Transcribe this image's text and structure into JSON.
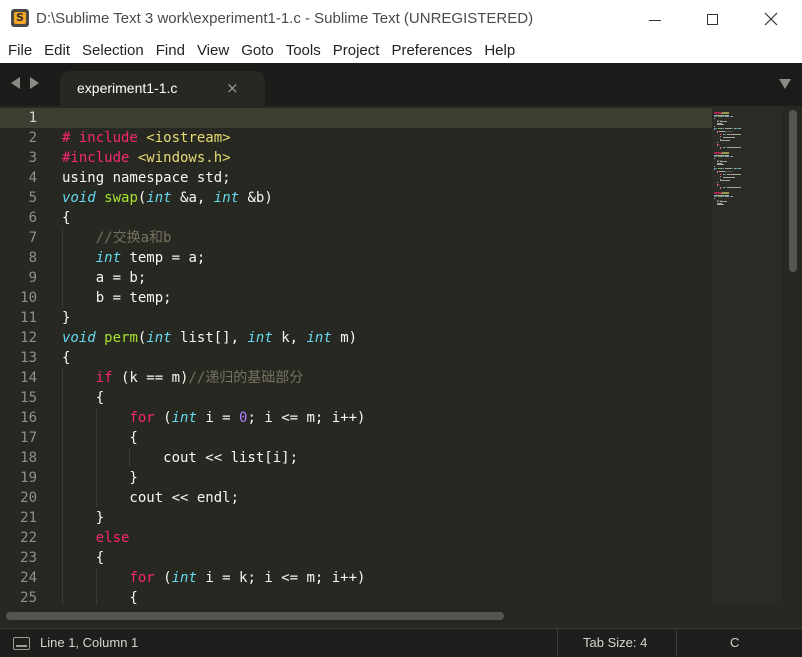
{
  "window": {
    "title": "D:\\Sublime Text 3 work\\experiment1-1.c - Sublime Text (UNREGISTERED)",
    "app_icon_letter": "S"
  },
  "menu": [
    "File",
    "Edit",
    "Selection",
    "Find",
    "View",
    "Goto",
    "Tools",
    "Project",
    "Preferences",
    "Help"
  ],
  "tab": {
    "label": "experiment1-1.c",
    "close_glyph": "×"
  },
  "editor": {
    "line_numbers": [
      "1",
      "2",
      "3",
      "4",
      "5",
      "6",
      "7",
      "8",
      "9",
      "10",
      "11",
      "12",
      "13",
      "14",
      "15",
      "16",
      "17",
      "18",
      "19",
      "20",
      "21",
      "22",
      "23",
      "24",
      "25"
    ],
    "current_line": 1,
    "lines": [
      [],
      [
        [
          "kw",
          "# include "
        ],
        [
          "st",
          "<iostream>"
        ]
      ],
      [
        [
          "kw",
          "#include "
        ],
        [
          "st",
          "<windows.h>"
        ]
      ],
      [
        [
          "pl",
          "using namespace std;"
        ]
      ],
      [
        [
          "ty",
          "void"
        ],
        [
          "pl",
          " "
        ],
        [
          "fn",
          "swap"
        ],
        [
          "pl",
          "("
        ],
        [
          "ty",
          "int"
        ],
        [
          "pl",
          " &a, "
        ],
        [
          "ty",
          "int"
        ],
        [
          "pl",
          " &b)"
        ]
      ],
      [
        [
          "pl",
          "{"
        ]
      ],
      [
        [
          "cm",
          "    //交换a和b"
        ]
      ],
      [
        [
          "pl",
          "    "
        ],
        [
          "ty",
          "int"
        ],
        [
          "pl",
          " temp = a;"
        ]
      ],
      [
        [
          "pl",
          "    a = b;"
        ]
      ],
      [
        [
          "pl",
          "    b = temp;"
        ]
      ],
      [
        [
          "pl",
          "}"
        ]
      ],
      [
        [
          "ty",
          "void"
        ],
        [
          "pl",
          " "
        ],
        [
          "fn",
          "perm"
        ],
        [
          "pl",
          "("
        ],
        [
          "ty",
          "int"
        ],
        [
          "pl",
          " list[], "
        ],
        [
          "ty",
          "int"
        ],
        [
          "pl",
          " k, "
        ],
        [
          "ty",
          "int"
        ],
        [
          "pl",
          " m)"
        ]
      ],
      [
        [
          "pl",
          "{"
        ]
      ],
      [
        [
          "pl",
          "    "
        ],
        [
          "kw",
          "if"
        ],
        [
          "pl",
          " (k == m)"
        ],
        [
          "cm",
          "//递归的基础部分"
        ]
      ],
      [
        [
          "pl",
          "    {"
        ]
      ],
      [
        [
          "pl",
          "        "
        ],
        [
          "kw",
          "for"
        ],
        [
          "pl",
          " ("
        ],
        [
          "ty",
          "int"
        ],
        [
          "pl",
          " i = "
        ],
        [
          "nu",
          "0"
        ],
        [
          "pl",
          "; i <= m; i++)"
        ]
      ],
      [
        [
          "pl",
          "        {"
        ]
      ],
      [
        [
          "pl",
          "            cout << list[i];"
        ]
      ],
      [
        [
          "pl",
          "        }"
        ]
      ],
      [
        [
          "pl",
          "        cout << endl;"
        ]
      ],
      [
        [
          "pl",
          "    }"
        ]
      ],
      [
        [
          "pl",
          "    "
        ],
        [
          "kw",
          "else"
        ]
      ],
      [
        [
          "pl",
          "    {"
        ]
      ],
      [
        [
          "pl",
          "        "
        ],
        [
          "kw",
          "for"
        ],
        [
          "pl",
          " ("
        ],
        [
          "ty",
          "int"
        ],
        [
          "pl",
          " i = k; i <= m; i++)"
        ]
      ],
      [
        [
          "pl",
          "        {"
        ]
      ]
    ]
  },
  "status": {
    "position": "Line 1, Column 1",
    "tab_size": "Tab Size: 4",
    "syntax": "C"
  },
  "colors": {
    "background": "#272822",
    "keyword": "#f92672",
    "type": "#66d9ef",
    "function": "#a6e22e",
    "string": "#e6db74",
    "number": "#ae81ff",
    "comment": "#75715e",
    "foreground": "#f8f8f2"
  },
  "icons": [
    "sublime-text-icon",
    "minimize-icon",
    "maximize-icon",
    "close-icon",
    "tab-nav-left-icon",
    "tab-nav-right-icon",
    "tab-close-icon",
    "tab-dropdown-icon",
    "panel-toggle-icon"
  ]
}
